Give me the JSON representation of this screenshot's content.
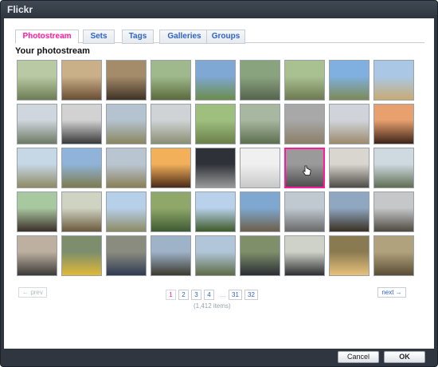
{
  "window": {
    "title": "Flickr"
  },
  "tabs": [
    {
      "label": "Photostream",
      "active": true
    },
    {
      "label": "Sets",
      "active": false
    },
    {
      "label": "Tags",
      "active": false
    },
    {
      "label": "Galleries",
      "active": false
    },
    {
      "label": "Groups",
      "active": false
    }
  ],
  "section_heading": "Your photostream",
  "selected_index": 24,
  "thumbnails": [
    "hole-in-field",
    "dirt-pit",
    "dirt-pit-closeup",
    "fenced-garden",
    "green-field",
    "marshland",
    "fenced-garden-2",
    "savanna-sky",
    "people-sitting",
    "tents-under-trees",
    "stone-ruin",
    "savanna-plain",
    "village-hut",
    "grassy-field",
    "savanna-trees",
    "dry-grassland",
    "savanna-horizon",
    "sunset-silhouette",
    "plain-horizon",
    "acacia-plain",
    "grass-road",
    "orange-sunset",
    "dusk-silhouette",
    "pale-sky",
    "bw-landscape",
    "car-interior",
    "man-portrait",
    "man-smiling",
    "buffalo-fight",
    "blue-sky-plain",
    "bushland",
    "treeline",
    "rock-outcrop",
    "people-in-village",
    "two-men-portrait",
    "man-in-cap",
    "man-with-bicycle",
    "man-in-yellow",
    "man-seated",
    "man-with-stick",
    "man-in-white",
    "man-working",
    "man-with-rope",
    "man-in-shade",
    "tree-and-men"
  ],
  "pagination": {
    "prev": "← prev",
    "next": "next →",
    "pages": [
      "1",
      "2",
      "3",
      "4",
      "31",
      "32"
    ],
    "current": "1",
    "ellipsis": "…",
    "count": "(1,412 items)"
  },
  "footer": {
    "cancel": "Cancel",
    "ok": "OK"
  },
  "colors": {
    "accent": "#ff1a9c",
    "link": "#2f63c4",
    "chrome": "#2f3640"
  }
}
